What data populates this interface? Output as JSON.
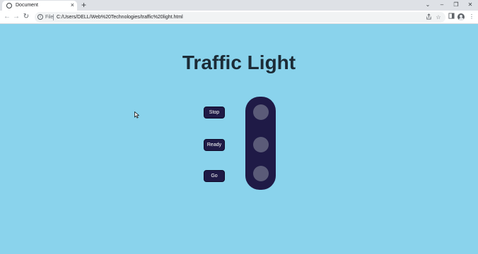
{
  "browser": {
    "tab_title": "Document",
    "tab_close": "×",
    "new_tab": "+",
    "back": "←",
    "forward": "→",
    "reload": "↻",
    "info": "i",
    "scheme": "File",
    "url": "C:/Users/DELL/Web%20Technologies/traffic%20light.html",
    "share_icon": "share-icon",
    "star_icon": "star-icon",
    "window_controls": [
      "⌄",
      "–",
      "❐",
      "✕"
    ],
    "menu": "⋮"
  },
  "page": {
    "title": "Traffic Light",
    "buttons": {
      "stop": "Stop",
      "ready": "Ready",
      "go": "Go"
    },
    "lamps": [
      "red-lamp",
      "yellow-lamp",
      "green-lamp"
    ],
    "colors": {
      "background": "#8ad3ec",
      "panel": "#1f1a46",
      "lamp_off": "#5b5b78",
      "title": "#1c2b36"
    }
  }
}
